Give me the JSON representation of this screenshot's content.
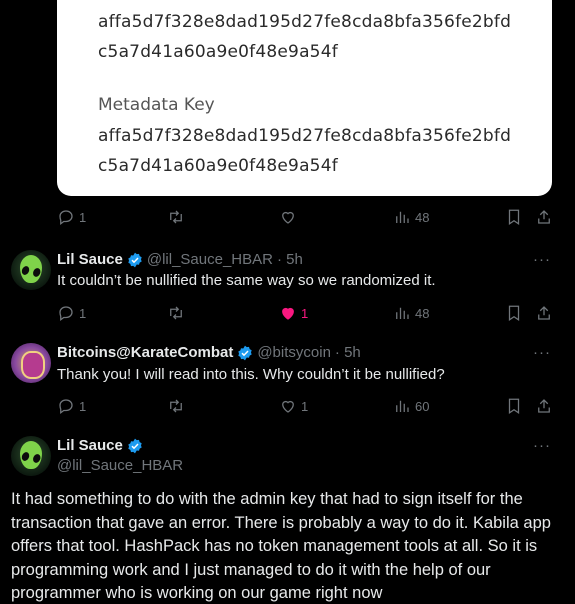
{
  "card": {
    "hash_line1": "affa5d7f328e8dad195d27fe8cda8bfa356fe2bfd",
    "hash_line2": "c5a7d41a60a9e0f48e9a54f",
    "metadata_label": "Metadata Key",
    "meta_line1": "affa5d7f328e8dad195d27fe8cda8bfa356fe2bfd",
    "meta_line2": "c5a7d41a60a9e0f48e9a54f"
  },
  "tweet0_actions": {
    "replies": "1",
    "retweets": "",
    "likes": "",
    "views": "48"
  },
  "tweet1": {
    "name": "Lil Sauce",
    "handle": "@lil_Sauce_HBAR",
    "time": "· 5h",
    "text": "It couldn’t be nullified the same way so we randomized it.",
    "actions": {
      "replies": "1",
      "retweets": "",
      "likes": "1",
      "views": "48"
    }
  },
  "tweet2": {
    "name": "Bitcoins@KarateCombat",
    "handle": "@bitsycoin",
    "time": "· 5h",
    "text": "Thank you! I will read into this. Why couldn’t it be nullified?",
    "actions": {
      "replies": "1",
      "retweets": "",
      "likes": "1",
      "views": "60"
    }
  },
  "tweet3": {
    "name": "Lil Sauce",
    "handle": "@lil_Sauce_HBAR",
    "text": "It had something to do with the admin key that had to sign itself for the transaction that gave an error. There is probably a way to do it. Kabila app offers that tool. HashPack has no token management tools at all. So it is programming work and I just managed to do it with the help of our programmer who is working on our game right now"
  },
  "more_label": "···",
  "colors": {
    "verified": "#1d9bf0",
    "like": "#f91880",
    "muted": "#71767b"
  },
  "icons": [
    "reply-icon",
    "retweet-icon",
    "like-icon",
    "views-icon",
    "bookmark-icon",
    "share-icon",
    "verified-badge-icon"
  ]
}
